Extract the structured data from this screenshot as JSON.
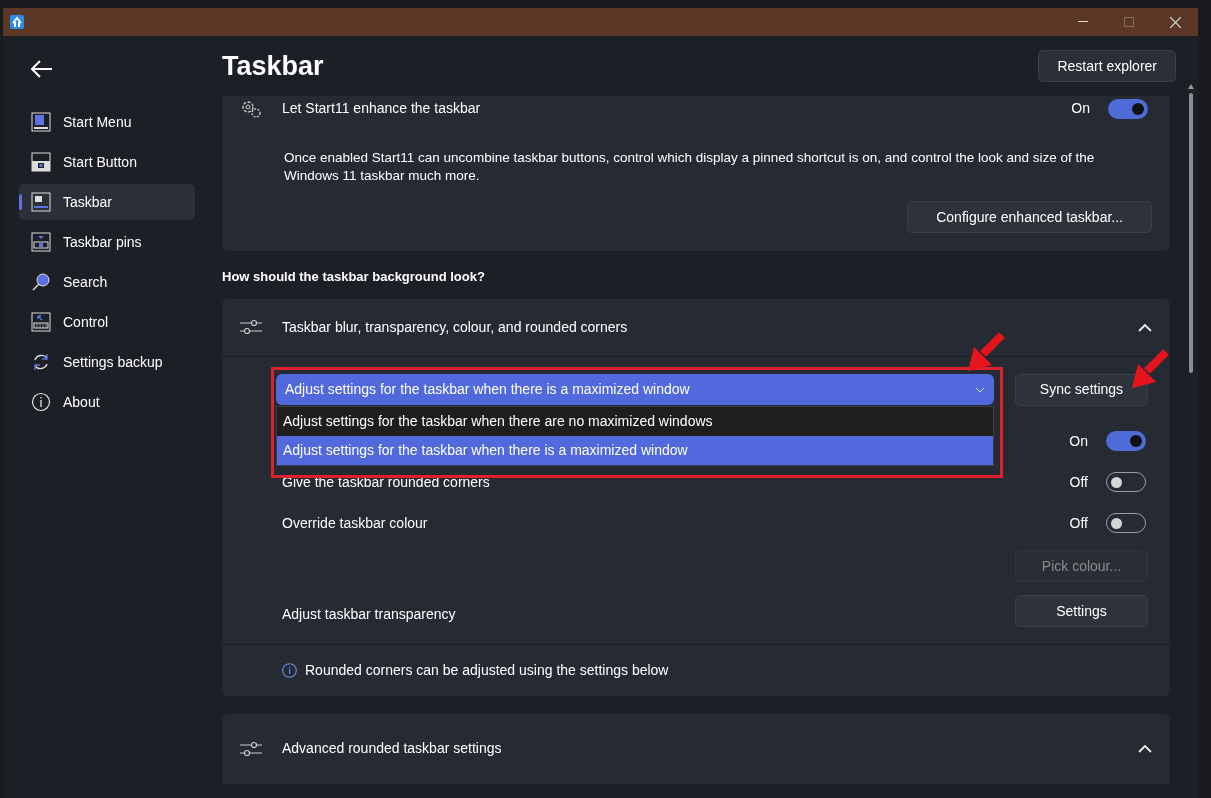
{
  "header": {
    "title": "Taskbar",
    "button": "Restart explorer"
  },
  "sidebar": {
    "items": [
      {
        "label": "Start Menu",
        "selected": false
      },
      {
        "label": "Start Button",
        "selected": false
      },
      {
        "label": "Taskbar",
        "selected": true
      },
      {
        "label": "Taskbar pins",
        "selected": false
      },
      {
        "label": "Search",
        "selected": false
      },
      {
        "label": "Control",
        "selected": false
      },
      {
        "label": "Settings backup",
        "selected": false
      },
      {
        "label": "About",
        "selected": false
      }
    ]
  },
  "enhance_card": {
    "label": "Let Start11 enhance the taskbar",
    "state_text": "On",
    "on": true,
    "description": "Once enabled Start11 can uncombine taskbar buttons, control which display a pinned shortcut is on, and control the look and size of the Windows 11 taskbar much more.",
    "button": "Configure enhanced taskbar..."
  },
  "section_heading": "How should the taskbar background look?",
  "background_card": {
    "title": "Taskbar blur, transparency, colour, and rounded corners",
    "expanded": true,
    "dropdown": {
      "value": "Adjust settings for the taskbar when there is a maximized window",
      "options": [
        {
          "label": "Adjust settings for the taskbar when there are no maximized windows",
          "selected": false
        },
        {
          "label": "Adjust settings for the taskbar when there is a maximized window",
          "selected": true
        }
      ]
    },
    "sync_button": "Sync settings",
    "rows": [
      {
        "kind": "toggle",
        "state_text": "On",
        "on": true
      },
      {
        "kind": "toggle",
        "label": "Give the taskbar rounded corners",
        "state_text": "Off",
        "on": false
      },
      {
        "kind": "toggle",
        "label": "Override taskbar colour",
        "state_text": "Off",
        "on": false
      },
      {
        "kind": "button",
        "button": "Pick colour...",
        "disabled": true
      },
      {
        "kind": "button",
        "label": "Adjust taskbar transparency",
        "button": "Settings",
        "disabled": false
      }
    ],
    "info": "Rounded corners can be adjusted using the settings below"
  },
  "advanced_card": {
    "title": "Advanced rounded taskbar settings",
    "expanded": true
  }
}
